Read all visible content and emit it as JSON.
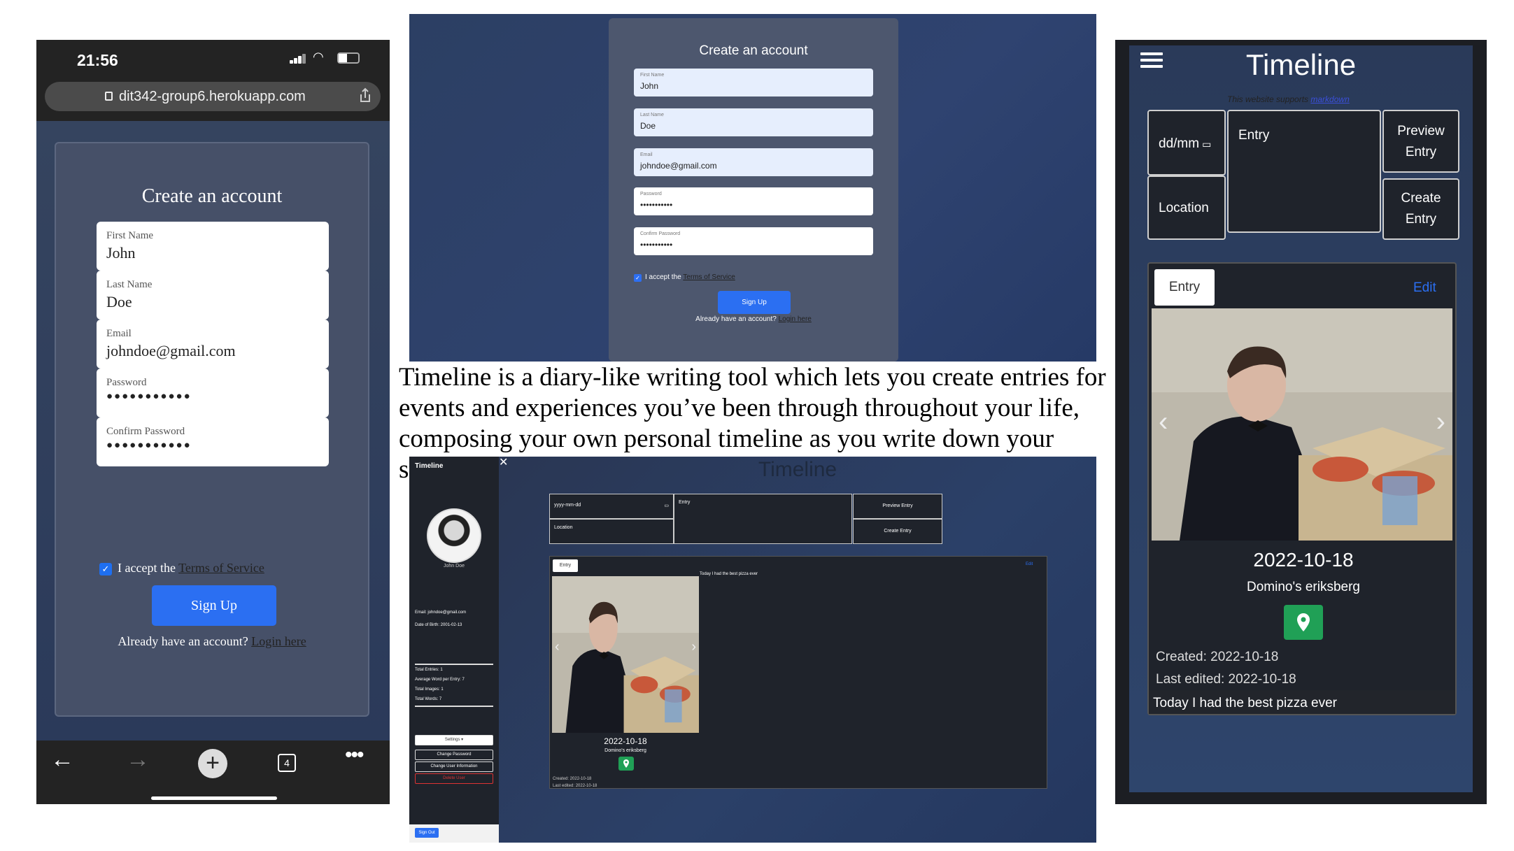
{
  "phone": {
    "time": "21:56",
    "url": "dit342-group6.herokuapp.com",
    "title": "Create an account",
    "fields": [
      {
        "label": "First Name",
        "value": "John"
      },
      {
        "label": "Last Name",
        "value": "Doe"
      },
      {
        "label": "Email",
        "value": "johndoe@gmail.com"
      },
      {
        "label": "Password",
        "value": "●●●●●●●●●●●"
      },
      {
        "label": "Confirm Password",
        "value": "●●●●●●●●●●●"
      }
    ],
    "accept_prefix": "I accept the ",
    "terms_link": "Terms of Service",
    "signup_label": "Sign Up",
    "login_prefix": "Already have an account? ",
    "login_link": "Login here",
    "tab_count": "4"
  },
  "desktop_signup": {
    "title": "Create an account",
    "fields": [
      {
        "label": "First Name",
        "value": "John"
      },
      {
        "label": "Last Name",
        "value": "Doe"
      },
      {
        "label": "Email",
        "value": "johndoe@gmail.com"
      },
      {
        "label": "Password",
        "value": "•••••••••••"
      },
      {
        "label": "Confirm Password",
        "value": "•••••••••••"
      }
    ],
    "accept_prefix": "I accept the ",
    "terms_link": "Terms of Service",
    "signup_label": "Sign Up",
    "login_prefix": "Already have an account? ",
    "login_link": "Login here"
  },
  "description": "Timeline is a diary-like writing tool which lets you create entries for events and experiences you’ve been through throughout your life, composing your own personal timeline as you write down your story.",
  "desktop_timeline": {
    "sidebar_title": "Timeline",
    "close": "✕",
    "user_name": "John Doe",
    "email": "Email: johndoe@gmail.com",
    "dob": "Date of Birth: 2001-02-13",
    "stats": [
      "Total Entries: 1",
      "Average Word per Entry: 7",
      "Total Images: 1",
      "Total Words: 7"
    ],
    "settings": "Settings ▾",
    "change_password": "Change Password",
    "change_user_info": "Change User Information",
    "delete_user": "Delete User",
    "sign_out": "Sign Out",
    "heading": "Timeline",
    "date_placeholder": "yyyy-mm-dd",
    "location_placeholder": "Location",
    "entry_placeholder": "Entry",
    "preview_button": "Preview Entry",
    "create_button": "Create Entry",
    "tab": "Entry",
    "edit": "Edit",
    "date": "2022-10-18",
    "place": "Domino's eriksberg",
    "created": "Created: 2022-10-18",
    "edited": "Last edited: 2022-10-18",
    "text": "Today I had the best pizza ever"
  },
  "mobile_timeline": {
    "title": "Timeline",
    "markdown_prefix": "This website supports ",
    "markdown_link": "markdown",
    "date_placeholder": "dd/mm",
    "location_placeholder": "Location",
    "entry_placeholder": "Entry",
    "preview_button": "Preview Entry",
    "create_button": "Create Entry",
    "tab": "Entry",
    "edit": "Edit",
    "date": "2022-10-18",
    "place": "Domino's eriksberg",
    "created": "Created: 2022-10-18",
    "edited": "Last edited: 2022-10-18",
    "text": "Today I had the best pizza ever"
  },
  "colors": {
    "accent": "#2b6ff2",
    "pin": "#20a056",
    "dark_panel": "#1f232b"
  },
  "icons": [
    "lock-icon",
    "share-icon",
    "back-icon",
    "forward-icon",
    "plus-icon",
    "tabs-icon",
    "more-icon",
    "hamburger-icon",
    "calendar-icon",
    "map-pin-icon",
    "chevron-left-icon",
    "chevron-right-icon"
  ]
}
